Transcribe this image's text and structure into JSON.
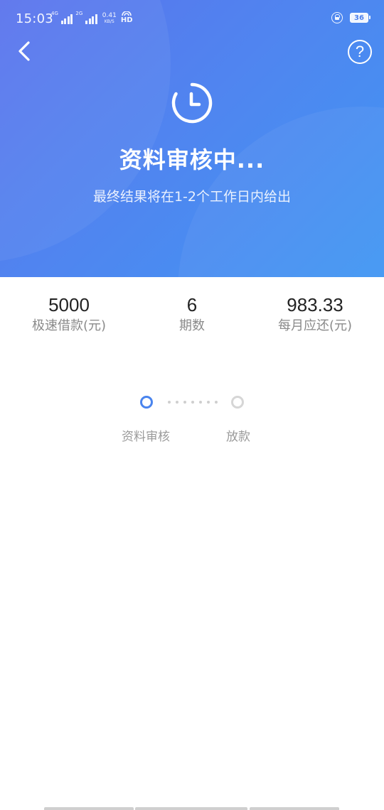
{
  "status_bar": {
    "time": "15:03",
    "network_1": "4G",
    "network_2": "2G",
    "speed_value": "0.41",
    "speed_unit": "KB/S",
    "hd_label": "HD",
    "battery_level": "36"
  },
  "header": {
    "title": "资料审核中...",
    "subtitle": "最终结果将在1-2个工作日内给出",
    "help_label": "?",
    "colors": {
      "gradient_start": "#5a73ec",
      "gradient_end": "#4096f3"
    }
  },
  "summary": [
    {
      "value": "5000",
      "label": "极速借款(元)"
    },
    {
      "value": "6",
      "label": "期数"
    },
    {
      "value": "983.33",
      "label": "每月应还(元)"
    }
  ],
  "progress": {
    "steps": [
      {
        "label": "资料审核",
        "state": "active"
      },
      {
        "label": "放款",
        "state": "pending"
      }
    ],
    "active_color": "#4a84ee",
    "pending_color": "#d6d6d6"
  }
}
